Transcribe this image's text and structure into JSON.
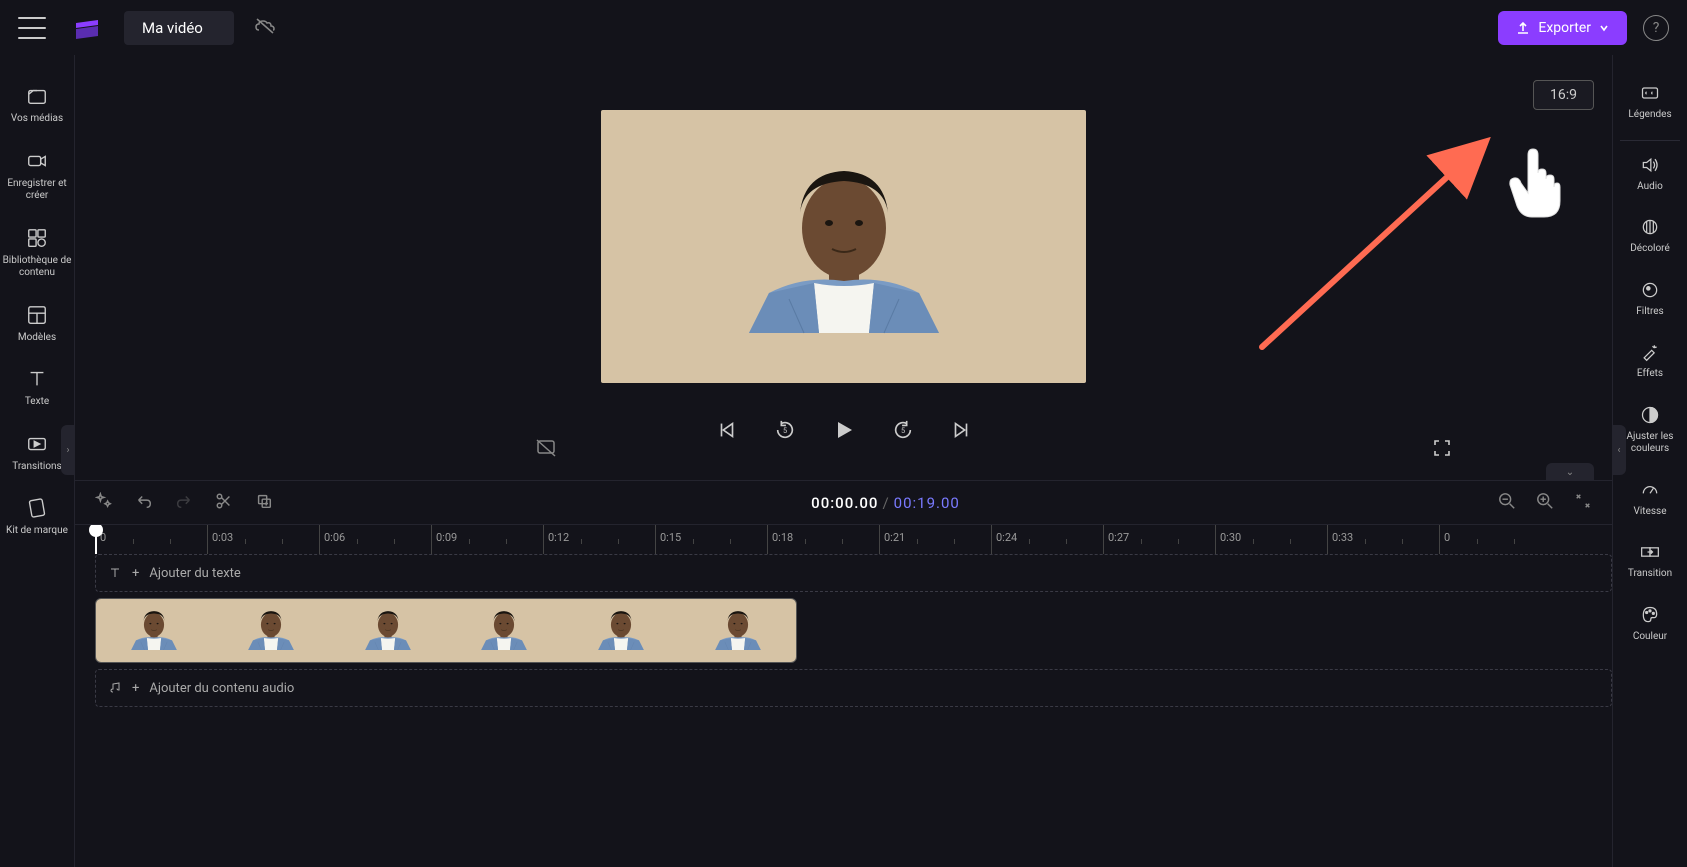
{
  "header": {
    "project_title": "Ma vidéo",
    "export_label": "Exporter"
  },
  "left_sidebar": [
    {
      "id": "media",
      "label": "Vos médias"
    },
    {
      "id": "record",
      "label": "Enregistrer et créer"
    },
    {
      "id": "library",
      "label": "Bibliothèque de contenu"
    },
    {
      "id": "templates",
      "label": "Modèles"
    },
    {
      "id": "text",
      "label": "Texte"
    },
    {
      "id": "transitions",
      "label": "Transitions"
    },
    {
      "id": "brandkit",
      "label": "Kit de marque"
    }
  ],
  "right_sidebar": [
    {
      "id": "captions",
      "label": "Légendes"
    },
    {
      "id": "audio",
      "label": "Audio"
    },
    {
      "id": "fade",
      "label": "Décoloré"
    },
    {
      "id": "filters",
      "label": "Filtres"
    },
    {
      "id": "effects",
      "label": "Effets"
    },
    {
      "id": "adjustcolors",
      "label": "Ajuster les couleurs"
    },
    {
      "id": "speed",
      "label": "Vitesse"
    },
    {
      "id": "transition",
      "label": "Transition"
    },
    {
      "id": "color",
      "label": "Couleur"
    }
  ],
  "preview": {
    "aspect_ratio": "16:9"
  },
  "timeline": {
    "current_time": "00:00.00",
    "duration": "00:19.00",
    "ruler_marks": [
      "0",
      "0:03",
      "0:06",
      "0:09",
      "0:12",
      "0:15",
      "0:18",
      "0:21",
      "0:24",
      "0:27",
      "0:30",
      "0:33",
      "0"
    ],
    "text_track_placeholder": "Ajouter du texte",
    "audio_track_placeholder": "Ajouter du contenu audio"
  },
  "colors": {
    "accent": "#8b3dff"
  }
}
